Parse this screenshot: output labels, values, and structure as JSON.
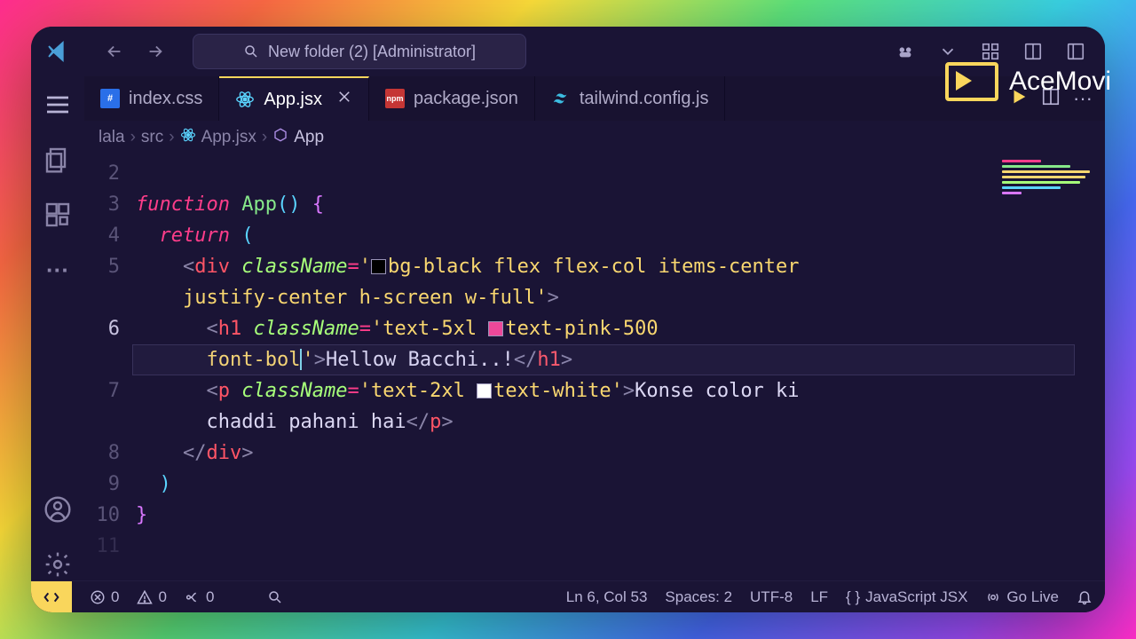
{
  "brand": "AceMovi",
  "titlebar": {
    "search": "New folder (2) [Administrator]"
  },
  "tabs": [
    {
      "label": "index.css",
      "icon": "css"
    },
    {
      "label": "App.jsx",
      "icon": "react",
      "active": true,
      "close": true
    },
    {
      "label": "package.json",
      "icon": "npm"
    },
    {
      "label": "tailwind.config.js",
      "icon": "tailwind"
    }
  ],
  "breadcrumb": {
    "p1": "lala",
    "p2": "src",
    "p3": "App.jsx",
    "p4": "App"
  },
  "code": {
    "l3_kw": "function",
    "l3_fn": "App",
    "l3_rest": "() {",
    "l4_kw": "return",
    "l4_rest": " (",
    "l5_tag": "div",
    "l5_attr": "className",
    "l5_str1": "'",
    "l5_str2": "bg-black flex flex-col items-center",
    "l5b_str": "justify-center h-screen w-full'",
    "l6_tag": "h1",
    "l6_attr": "className",
    "l6_str1": "'text-5xl ",
    "l6_str2": "text-pink-500",
    "l6b_str1": "font-bol",
    "l6b_txt": "Hellow Bacchi..!",
    "l7_tag": "p",
    "l7_attr": "className",
    "l7_str1": "'text-2xl ",
    "l7_str2": "text-white'",
    "l7_txt": "Konse color ki",
    "l7b_txt": "chaddi pahani hai",
    "l8_tag": "div"
  },
  "line_numbers": [
    "2",
    "3",
    "4",
    "5",
    "6",
    "7",
    "8",
    "9",
    "10",
    "11"
  ],
  "status": {
    "errors": "0",
    "warnings": "0",
    "ports": "0",
    "pos": "Ln 6, Col 53",
    "spaces": "Spaces: 2",
    "encoding": "UTF-8",
    "eol": "LF",
    "lang": "JavaScript JSX",
    "golive": "Go Live"
  }
}
